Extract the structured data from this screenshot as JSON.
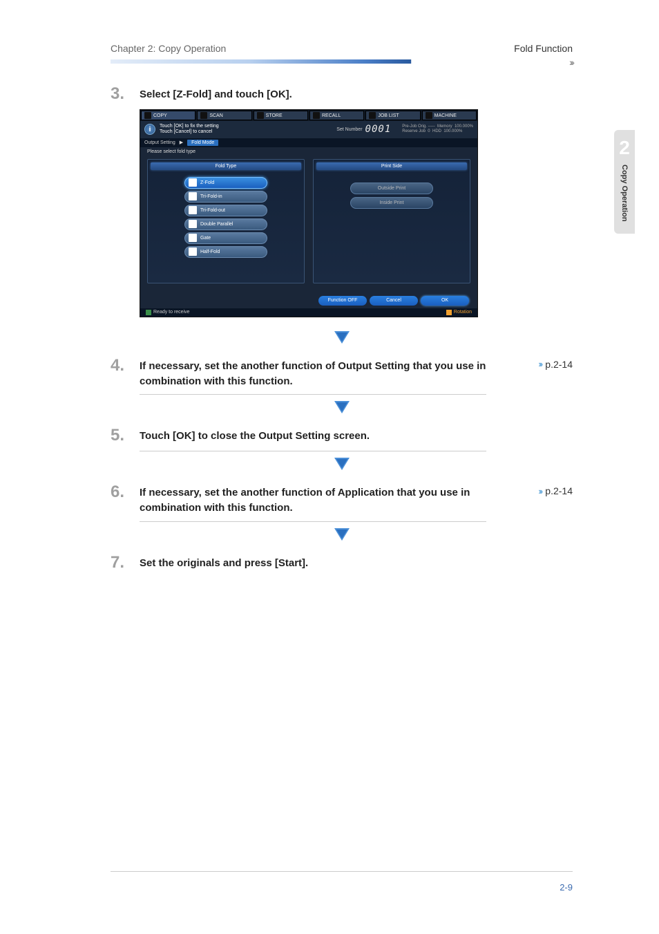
{
  "header": {
    "chapter": "Chapter 2: Copy Operation",
    "section": "Fold Function"
  },
  "sideTab": {
    "number": "2",
    "label": "Copy Operation"
  },
  "steps": {
    "s3": {
      "num": "3.",
      "text": "Select [Z-Fold] and touch [OK]."
    },
    "s4": {
      "num": "4.",
      "text": "If necessary, set the another function of Output Setting that you use in combination with this function.",
      "ref": "p.2-14"
    },
    "s5": {
      "num": "5.",
      "text": "Touch [OK] to close the Output Setting screen."
    },
    "s6": {
      "num": "6.",
      "text": "If necessary, set the another function of Application that you use in combination with this function.",
      "ref": "p.2-14"
    },
    "s7": {
      "num": "7.",
      "text": "Set the originals and press [Start]."
    }
  },
  "screenshot": {
    "tabs": {
      "copy": "COPY",
      "scan": "SCAN",
      "store": "STORE",
      "recall": "RECALL",
      "joblist": "JOB LIST",
      "machine": "MACHINE"
    },
    "info": {
      "line1": "Touch [OK] to fix the setting",
      "line2": "Touch [Cancel] to cancel"
    },
    "setNumber": {
      "label": "Set Number",
      "value": "0001"
    },
    "status": {
      "prejob": "Pre-Job Orig. -----",
      "memory": "Memory",
      "mem_pct": "100.000%",
      "reserve": "Reserve Job",
      "reserve_val": "0",
      "hdd": "HDD",
      "hdd_pct": "100.000%"
    },
    "breadcrumb": {
      "a": "Output Setting",
      "b": "Fold Mode"
    },
    "subheader": "Please select fold type",
    "panels": {
      "foldType": "Fold Type",
      "printSide": "Print Side"
    },
    "foldButtons": {
      "zfold": "Z-Fold",
      "triin": "Tri-Fold-in",
      "triout": "Tri-Fold-out",
      "double": "Double Parallel",
      "gate": "Gate",
      "half": "Half-Fold"
    },
    "printButtons": {
      "outside": "Outside Print",
      "inside": "Inside Print"
    },
    "bottomButtons": {
      "off": "Function OFF",
      "cancel": "Cancel",
      "ok": "OK"
    },
    "statusbar": {
      "ready": "Ready to receive",
      "rotation": "Rotation"
    }
  },
  "pageNumber": "2-9"
}
